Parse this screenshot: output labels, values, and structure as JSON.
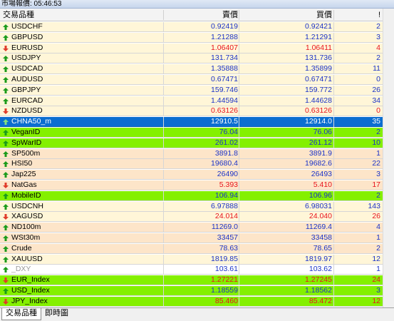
{
  "window": {
    "title": "市場報價: 05:46:53"
  },
  "columns": {
    "symbol": "交易品種",
    "bid": "賣價",
    "ask": "買價",
    "spread": "!"
  },
  "colors": {
    "up": "#1b9b1b",
    "down": "#e03b2a",
    "blue_text": "#1a33c8",
    "red_text": "#e8141e",
    "row_yellow": "#fff6d8",
    "row_orange": "#fde5c9",
    "row_green": "#84f000",
    "row_white": "#ffffff",
    "row_selected": "#0b6ed0"
  },
  "rows": [
    {
      "symbol": "USDCHF",
      "bid": "0.92419",
      "ask": "0.92421",
      "spread": "2",
      "bg": "yellow",
      "dir": "up",
      "tone": "blue"
    },
    {
      "symbol": "GBPUSD",
      "bid": "1.21288",
      "ask": "1.21291",
      "spread": "3",
      "bg": "yellow",
      "dir": "up",
      "tone": "blue"
    },
    {
      "symbol": "EURUSD",
      "bid": "1.06407",
      "ask": "1.06411",
      "spread": "4",
      "bg": "yellow",
      "dir": "down",
      "tone": "red"
    },
    {
      "symbol": "USDJPY",
      "bid": "131.734",
      "ask": "131.736",
      "spread": "2",
      "bg": "yellow",
      "dir": "up",
      "tone": "blue"
    },
    {
      "symbol": "USDCAD",
      "bid": "1.35888",
      "ask": "1.35899",
      "spread": "11",
      "bg": "yellow",
      "dir": "up",
      "tone": "blue"
    },
    {
      "symbol": "AUDUSD",
      "bid": "0.67471",
      "ask": "0.67471",
      "spread": "0",
      "bg": "yellow",
      "dir": "up",
      "tone": "blue"
    },
    {
      "symbol": "GBPJPY",
      "bid": "159.746",
      "ask": "159.772",
      "spread": "26",
      "bg": "yellow",
      "dir": "up",
      "tone": "blue"
    },
    {
      "symbol": "EURCAD",
      "bid": "1.44594",
      "ask": "1.44628",
      "spread": "34",
      "bg": "yellow",
      "dir": "up",
      "tone": "blue"
    },
    {
      "symbol": "NZDUSD",
      "bid": "0.63126",
      "ask": "0.63126",
      "spread": "0",
      "bg": "yellow",
      "dir": "down",
      "tone": "red"
    },
    {
      "symbol": "CHNA50_m",
      "bid": "12910.5",
      "ask": "12914.0",
      "spread": "35",
      "bg": "selected",
      "dir": "up",
      "tone": "white"
    },
    {
      "symbol": "VeganID",
      "bid": "76.04",
      "ask": "76.06",
      "spread": "2",
      "bg": "green",
      "dir": "up",
      "tone": "blue"
    },
    {
      "symbol": "SpWarID",
      "bid": "261.02",
      "ask": "261.12",
      "spread": "10",
      "bg": "green",
      "dir": "up",
      "tone": "blue"
    },
    {
      "symbol": "SP500m",
      "bid": "3891.8",
      "ask": "3891.9",
      "spread": "1",
      "bg": "orange",
      "dir": "up",
      "tone": "blue"
    },
    {
      "symbol": "HSI50",
      "bid": "19680.4",
      "ask": "19682.6",
      "spread": "22",
      "bg": "orange",
      "dir": "up",
      "tone": "blue"
    },
    {
      "symbol": "Jap225",
      "bid": "26490",
      "ask": "26493",
      "spread": "3",
      "bg": "orange",
      "dir": "up",
      "tone": "blue"
    },
    {
      "symbol": "NatGas",
      "bid": "5.393",
      "ask": "5.410",
      "spread": "17",
      "bg": "orange",
      "dir": "down",
      "tone": "red"
    },
    {
      "symbol": "MobileID",
      "bid": "106.94",
      "ask": "106.96",
      "spread": "2",
      "bg": "green",
      "dir": "up",
      "tone": "blue"
    },
    {
      "symbol": "USDCNH",
      "bid": "6.97888",
      "ask": "6.98031",
      "spread": "143",
      "bg": "yellow",
      "dir": "up",
      "tone": "blue"
    },
    {
      "symbol": "XAGUSD",
      "bid": "24.014",
      "ask": "24.040",
      "spread": "26",
      "bg": "yellow",
      "dir": "down",
      "tone": "red"
    },
    {
      "symbol": "ND100m",
      "bid": "11269.0",
      "ask": "11269.4",
      "spread": "4",
      "bg": "orange",
      "dir": "up",
      "tone": "blue"
    },
    {
      "symbol": "WSt30m",
      "bid": "33457",
      "ask": "33458",
      "spread": "1",
      "bg": "orange",
      "dir": "up",
      "tone": "blue"
    },
    {
      "symbol": "Crude",
      "bid": "78.63",
      "ask": "78.65",
      "spread": "2",
      "bg": "orange",
      "dir": "up",
      "tone": "blue"
    },
    {
      "symbol": "XAUUSD",
      "bid": "1819.85",
      "ask": "1819.97",
      "spread": "12",
      "bg": "yellow",
      "dir": "up",
      "tone": "blue"
    },
    {
      "symbol": "_DXY",
      "bid": "103.61",
      "ask": "103.62",
      "spread": "1",
      "bg": "white",
      "dir": "up",
      "tone": "blue"
    },
    {
      "symbol": "EUR_Index",
      "bid": "1.27221",
      "ask": "1.27245",
      "spread": "24",
      "bg": "green",
      "dir": "down",
      "tone": "red"
    },
    {
      "symbol": "USD_Index",
      "bid": "1.18559",
      "ask": "1.18562",
      "spread": "3",
      "bg": "green",
      "dir": "up",
      "tone": "blue"
    },
    {
      "symbol": "JPY_Index",
      "bid": "85.460",
      "ask": "85.472",
      "spread": "12",
      "bg": "green",
      "dir": "down",
      "tone": "red"
    }
  ],
  "tabs": [
    {
      "label": "交易品種",
      "active": true
    },
    {
      "label": "即時圖",
      "active": false
    }
  ]
}
